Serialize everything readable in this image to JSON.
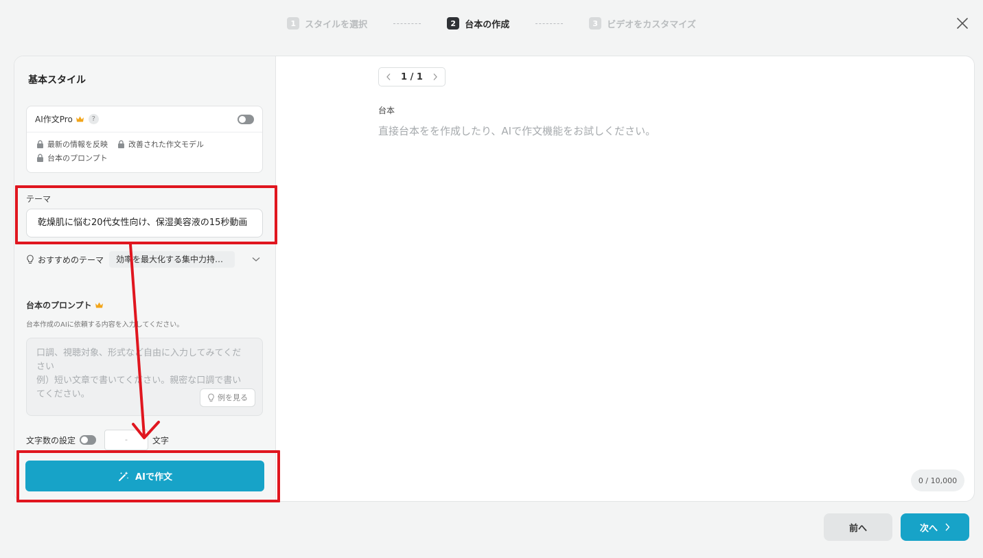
{
  "stepper": {
    "steps": [
      {
        "num": "1",
        "label": "スタイルを選択"
      },
      {
        "num": "2",
        "label": "台本の作成"
      },
      {
        "num": "3",
        "label": "ビデオをカスタマイズ"
      }
    ]
  },
  "left": {
    "title": "基本スタイル",
    "pro": {
      "title": "AI作文Pro",
      "help": "?",
      "features": [
        "最新の情報を反映",
        "改善された作文モデル",
        "台本のプロンプト"
      ]
    },
    "theme": {
      "label": "テーマ",
      "value": "乾燥肌に悩む20代女性向け、保湿美容液の15秒動画"
    },
    "recommend": {
      "label": "おすすめのテーマ",
      "value": "効率を最大化する集中力持続の秘訣"
    },
    "prompt": {
      "label": "台本のプロンプト",
      "description": "台本作成のAIに依頼する内容を入力してください。",
      "placeholder": "口調、視聴対象、形式など自由に入力してみてください\n例）短い文章で書いてください。親密な口調で書いてください。",
      "example_button": "例を見る"
    },
    "char_count": {
      "label": "文字数の設定",
      "value": "-",
      "unit": "文字"
    },
    "ai_button": "AIで作文"
  },
  "right": {
    "pager": "1 / 1",
    "script_label": "台本",
    "script_placeholder": "直接台本をを作成したり、AIで作文機能をお試しください。",
    "counter": "0 / 10,000"
  },
  "footer": {
    "prev": "前へ",
    "next": "次へ"
  },
  "colors": {
    "accent": "#17a3c8",
    "annotation": "#e0161f",
    "crown": "#f2a51a"
  }
}
